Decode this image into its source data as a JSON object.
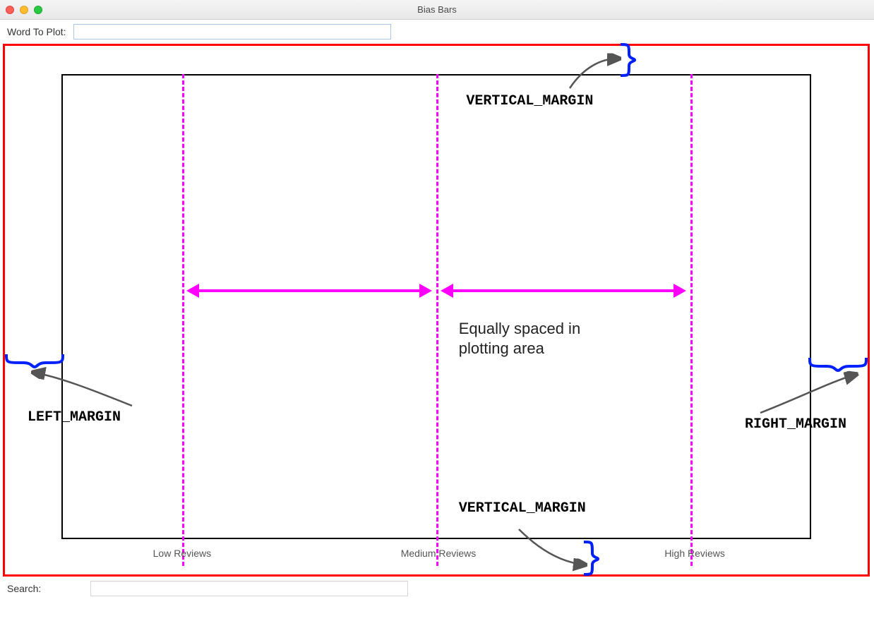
{
  "window": {
    "title": "Bias Bars"
  },
  "inputs": {
    "word_to_plot_label": "Word To Plot:",
    "word_to_plot_value": "",
    "search_label": "Search:",
    "search_value": ""
  },
  "axis": {
    "low": "Low Reviews",
    "medium": "Medium Reviews",
    "high": "High Reviews"
  },
  "annotations": {
    "vertical_margin": "VERTICAL_MARGIN",
    "left_margin": "LEFT_MARGIN",
    "right_margin": "RIGHT_MARGIN",
    "equal_spacing_line1": "Equally spaced in",
    "equal_spacing_line2": "plotting area"
  },
  "layout": {
    "vline_positions_pct": [
      16,
      50,
      84
    ]
  },
  "colors": {
    "outline": "#ff0000",
    "dashed": "#ff00ff",
    "brace": "#0020ff",
    "anno_arrow": "#555555"
  }
}
